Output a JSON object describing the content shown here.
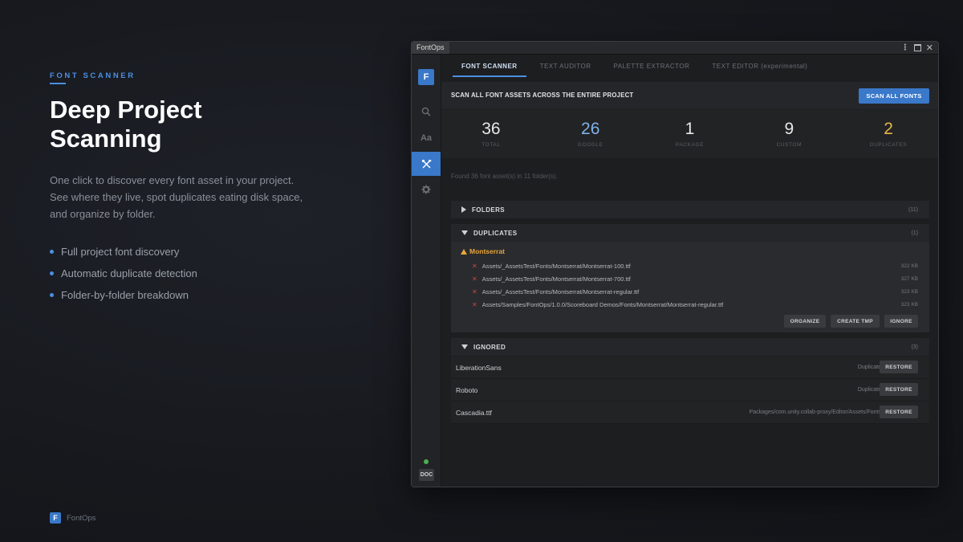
{
  "hero": {
    "eyebrow": "FONT SCANNER",
    "headline": "Deep Project Scanning",
    "description": "One click to discover every font asset in your project. See where they live, spot duplicates eating disk space, and organize by folder.",
    "features": [
      "Full project font discovery",
      "Automatic duplicate detection",
      "Folder-by-folder breakdown"
    ]
  },
  "brand": {
    "logo_letter": "F",
    "name": "FontOps"
  },
  "window": {
    "title": "FontOps",
    "sidebar": {
      "logo_letter": "F",
      "items": [
        {
          "icon": "search-icon"
        },
        {
          "icon": "font-icon",
          "text": "Aa"
        },
        {
          "icon": "tools-icon",
          "active": true
        },
        {
          "icon": "gear-icon"
        }
      ],
      "doc_label": "DOC"
    },
    "tabs": [
      {
        "label": "FONT SCANNER",
        "active": true
      },
      {
        "label": "TEXT AUDITOR"
      },
      {
        "label": "PALETTE EXTRACTOR"
      },
      {
        "label": "TEXT EDITOR (experimental)"
      }
    ],
    "scan": {
      "title": "SCAN ALL FONT ASSETS ACROSS THE ENTIRE PROJECT",
      "button": "SCAN ALL FONTS"
    },
    "stats": [
      {
        "value": "36",
        "label": "TOTAL",
        "color": "#e6e7e9"
      },
      {
        "value": "26",
        "label": "GOOGLE",
        "color": "#7fb2ea"
      },
      {
        "value": "1",
        "label": "PACKAGE",
        "color": "#e6e7e9"
      },
      {
        "value": "9",
        "label": "CUSTOM",
        "color": "#e6e7e9"
      },
      {
        "value": "2",
        "label": "DUPLICATES",
        "color": "#e8b54a"
      }
    ],
    "found_text": "Found 36 font asset(s) in 11 folder(s).",
    "folders": {
      "title": "FOLDERS",
      "count": "(11)"
    },
    "duplicates": {
      "title": "DUPLICATES",
      "count": "(1)",
      "group": "Montserrat",
      "files": [
        {
          "path": "Assets/_AssetsTest/Fonts/Montserrat/Montserrat-100.ttf",
          "size": "322 KB"
        },
        {
          "path": "Assets/_AssetsTest/Fonts/Montserrat/Montserrat-700.ttf",
          "size": "327 KB"
        },
        {
          "path": "Assets/_AssetsTest/Fonts/Montserrat/Montserrat-regular.ttf",
          "size": "323 KB"
        },
        {
          "path": "Assets/Samples/FontOps/1.0.0/Scoreboard Demos/Fonts/Montserrat/Montserrat-regular.ttf",
          "size": "323 KB"
        }
      ],
      "actions": [
        "ORGANIZE",
        "CREATE TMP",
        "IGNORE"
      ]
    },
    "ignored": {
      "title": "IGNORED",
      "count": "(3)",
      "items": [
        {
          "name": "LiberationSans",
          "info": "Duplicate",
          "action": "RESTORE"
        },
        {
          "name": "Roboto",
          "info": "Duplicate",
          "action": "RESTORE"
        },
        {
          "name": "Cascadia.ttf",
          "info": "Packages/com.unity.collab-proxy/Editor/Assets/Fonts",
          "action": "RESTORE"
        }
      ]
    }
  }
}
